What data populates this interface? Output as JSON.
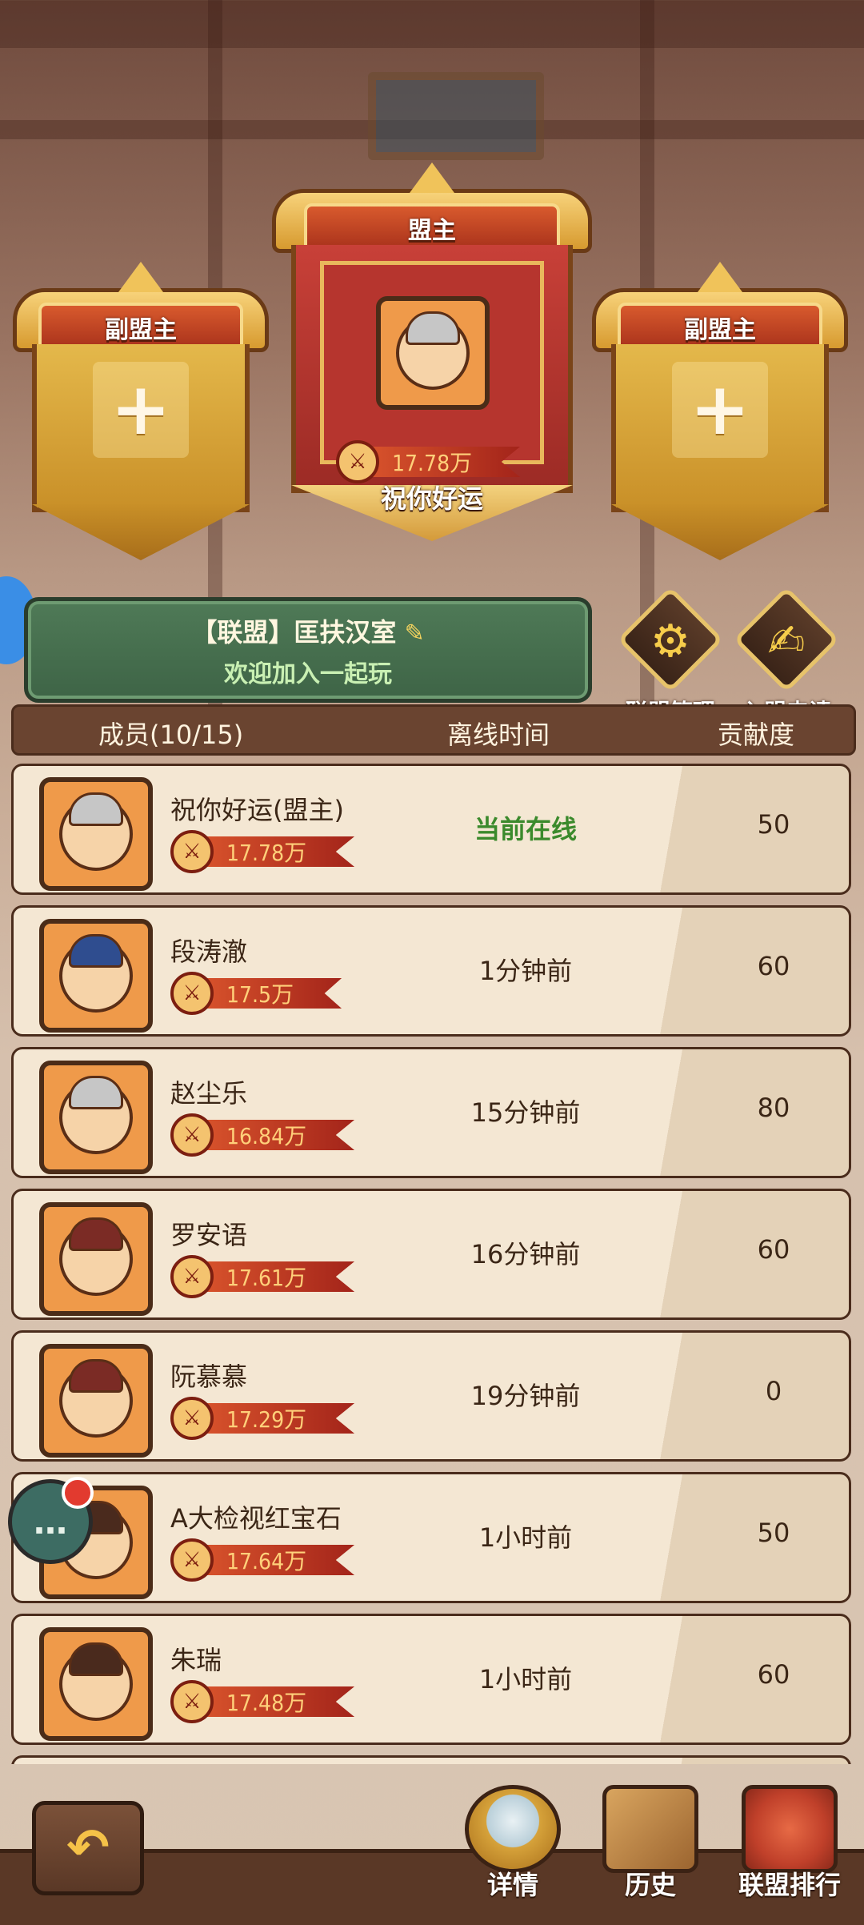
{
  "slots": {
    "left_title": "副盟主",
    "leader_title": "盟主",
    "right_title": "副盟主",
    "leader_power": "17.78万",
    "leader_name": "祝你好运"
  },
  "alliance": {
    "name": "【联盟】匡扶汉室",
    "motto": "欢迎加入一起玩",
    "manage_label": "联盟管理",
    "apply_label": "入盟申请"
  },
  "table": {
    "col_member": "成员(10/15)",
    "col_offline": "离线时间",
    "col_contrib": "贡献度"
  },
  "members": [
    {
      "name": "祝你好运(盟主)",
      "power": "17.78万",
      "offline": "当前在线",
      "contrib": "50",
      "online": true
    },
    {
      "name": "段涛澈",
      "power": "17.5万",
      "offline": "1分钟前",
      "contrib": "60"
    },
    {
      "name": "赵尘乐",
      "power": "16.84万",
      "offline": "15分钟前",
      "contrib": "80"
    },
    {
      "name": "罗安语",
      "power": "17.61万",
      "offline": "16分钟前",
      "contrib": "60"
    },
    {
      "name": "阮慕慕",
      "power": "17.29万",
      "offline": "19分钟前",
      "contrib": "0"
    },
    {
      "name": "A大检视红宝石",
      "power": "17.64万",
      "offline": "1小时前",
      "contrib": "50"
    },
    {
      "name": "朱瑞",
      "power": "17.48万",
      "offline": "1小时前",
      "contrib": "60"
    }
  ],
  "nav": {
    "detail": "详情",
    "history": "历史",
    "rank": "联盟排行"
  },
  "icons": {
    "back": "back-arrow-icon",
    "chat": "chat-bubble-icon",
    "manage": "gear-icon",
    "apply": "edit-note-icon",
    "power": "crossed-swords-icon",
    "add": "plus-icon"
  }
}
